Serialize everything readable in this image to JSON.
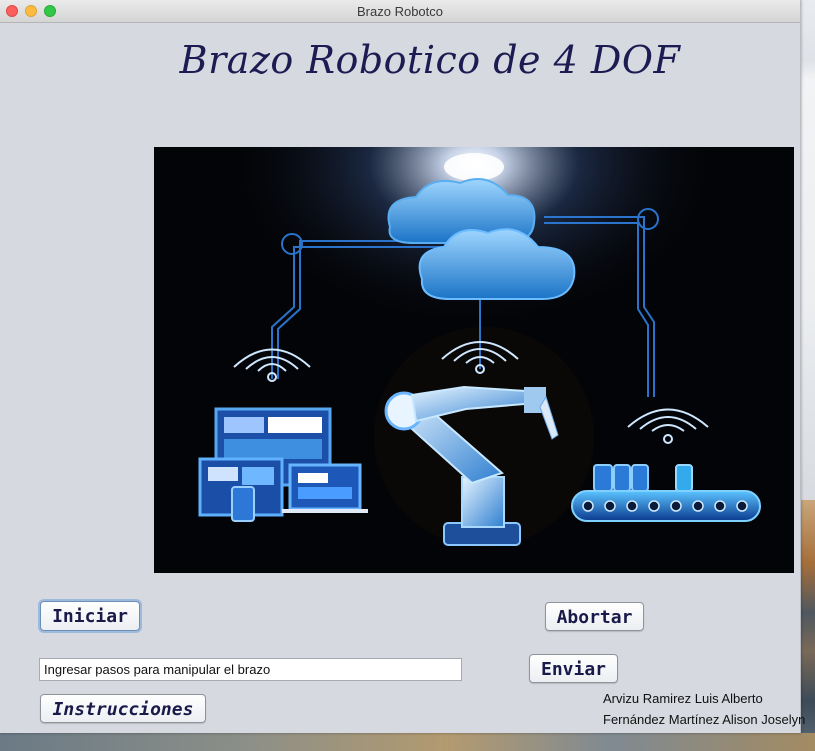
{
  "window": {
    "title": "Brazo Robotco"
  },
  "header": {
    "title": "Brazo Robotico de 4 DOF"
  },
  "buttons": {
    "start": "Iniciar",
    "abort": "Abortar",
    "send": "Enviar",
    "instructions": "Instrucciones"
  },
  "steps_input": {
    "value": "Ingresar pasos para manipular el brazo",
    "placeholder": ""
  },
  "authors": [
    "Arvizu Ramirez Luis Alberto",
    "Fernández Martínez Alison Joselyn"
  ],
  "colors": {
    "title_text": "#1c1b52",
    "window_bg": "#d6d9e0",
    "accent_glow": "#3ab0ff"
  }
}
